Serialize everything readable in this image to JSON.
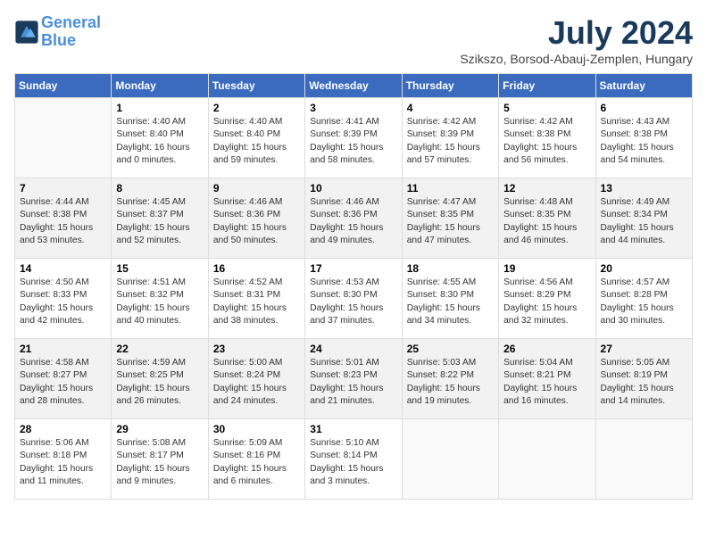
{
  "header": {
    "logo_line1": "General",
    "logo_line2": "Blue",
    "month": "July 2024",
    "location": "Szikszo, Borsod-Abauj-Zemplen, Hungary"
  },
  "days_of_week": [
    "Sunday",
    "Monday",
    "Tuesday",
    "Wednesday",
    "Thursday",
    "Friday",
    "Saturday"
  ],
  "weeks": [
    [
      {
        "day": "",
        "info": ""
      },
      {
        "day": "1",
        "info": "Sunrise: 4:40 AM\nSunset: 8:40 PM\nDaylight: 16 hours\nand 0 minutes."
      },
      {
        "day": "2",
        "info": "Sunrise: 4:40 AM\nSunset: 8:40 PM\nDaylight: 15 hours\nand 59 minutes."
      },
      {
        "day": "3",
        "info": "Sunrise: 4:41 AM\nSunset: 8:39 PM\nDaylight: 15 hours\nand 58 minutes."
      },
      {
        "day": "4",
        "info": "Sunrise: 4:42 AM\nSunset: 8:39 PM\nDaylight: 15 hours\nand 57 minutes."
      },
      {
        "day": "5",
        "info": "Sunrise: 4:42 AM\nSunset: 8:38 PM\nDaylight: 15 hours\nand 56 minutes."
      },
      {
        "day": "6",
        "info": "Sunrise: 4:43 AM\nSunset: 8:38 PM\nDaylight: 15 hours\nand 54 minutes."
      }
    ],
    [
      {
        "day": "7",
        "info": "Sunrise: 4:44 AM\nSunset: 8:38 PM\nDaylight: 15 hours\nand 53 minutes."
      },
      {
        "day": "8",
        "info": "Sunrise: 4:45 AM\nSunset: 8:37 PM\nDaylight: 15 hours\nand 52 minutes."
      },
      {
        "day": "9",
        "info": "Sunrise: 4:46 AM\nSunset: 8:36 PM\nDaylight: 15 hours\nand 50 minutes."
      },
      {
        "day": "10",
        "info": "Sunrise: 4:46 AM\nSunset: 8:36 PM\nDaylight: 15 hours\nand 49 minutes."
      },
      {
        "day": "11",
        "info": "Sunrise: 4:47 AM\nSunset: 8:35 PM\nDaylight: 15 hours\nand 47 minutes."
      },
      {
        "day": "12",
        "info": "Sunrise: 4:48 AM\nSunset: 8:35 PM\nDaylight: 15 hours\nand 46 minutes."
      },
      {
        "day": "13",
        "info": "Sunrise: 4:49 AM\nSunset: 8:34 PM\nDaylight: 15 hours\nand 44 minutes."
      }
    ],
    [
      {
        "day": "14",
        "info": "Sunrise: 4:50 AM\nSunset: 8:33 PM\nDaylight: 15 hours\nand 42 minutes."
      },
      {
        "day": "15",
        "info": "Sunrise: 4:51 AM\nSunset: 8:32 PM\nDaylight: 15 hours\nand 40 minutes."
      },
      {
        "day": "16",
        "info": "Sunrise: 4:52 AM\nSunset: 8:31 PM\nDaylight: 15 hours\nand 38 minutes."
      },
      {
        "day": "17",
        "info": "Sunrise: 4:53 AM\nSunset: 8:30 PM\nDaylight: 15 hours\nand 37 minutes."
      },
      {
        "day": "18",
        "info": "Sunrise: 4:55 AM\nSunset: 8:30 PM\nDaylight: 15 hours\nand 34 minutes."
      },
      {
        "day": "19",
        "info": "Sunrise: 4:56 AM\nSunset: 8:29 PM\nDaylight: 15 hours\nand 32 minutes."
      },
      {
        "day": "20",
        "info": "Sunrise: 4:57 AM\nSunset: 8:28 PM\nDaylight: 15 hours\nand 30 minutes."
      }
    ],
    [
      {
        "day": "21",
        "info": "Sunrise: 4:58 AM\nSunset: 8:27 PM\nDaylight: 15 hours\nand 28 minutes."
      },
      {
        "day": "22",
        "info": "Sunrise: 4:59 AM\nSunset: 8:25 PM\nDaylight: 15 hours\nand 26 minutes."
      },
      {
        "day": "23",
        "info": "Sunrise: 5:00 AM\nSunset: 8:24 PM\nDaylight: 15 hours\nand 24 minutes."
      },
      {
        "day": "24",
        "info": "Sunrise: 5:01 AM\nSunset: 8:23 PM\nDaylight: 15 hours\nand 21 minutes."
      },
      {
        "day": "25",
        "info": "Sunrise: 5:03 AM\nSunset: 8:22 PM\nDaylight: 15 hours\nand 19 minutes."
      },
      {
        "day": "26",
        "info": "Sunrise: 5:04 AM\nSunset: 8:21 PM\nDaylight: 15 hours\nand 16 minutes."
      },
      {
        "day": "27",
        "info": "Sunrise: 5:05 AM\nSunset: 8:19 PM\nDaylight: 15 hours\nand 14 minutes."
      }
    ],
    [
      {
        "day": "28",
        "info": "Sunrise: 5:06 AM\nSunset: 8:18 PM\nDaylight: 15 hours\nand 11 minutes."
      },
      {
        "day": "29",
        "info": "Sunrise: 5:08 AM\nSunset: 8:17 PM\nDaylight: 15 hours\nand 9 minutes."
      },
      {
        "day": "30",
        "info": "Sunrise: 5:09 AM\nSunset: 8:16 PM\nDaylight: 15 hours\nand 6 minutes."
      },
      {
        "day": "31",
        "info": "Sunrise: 5:10 AM\nSunset: 8:14 PM\nDaylight: 15 hours\nand 3 minutes."
      },
      {
        "day": "",
        "info": ""
      },
      {
        "day": "",
        "info": ""
      },
      {
        "day": "",
        "info": ""
      }
    ]
  ]
}
